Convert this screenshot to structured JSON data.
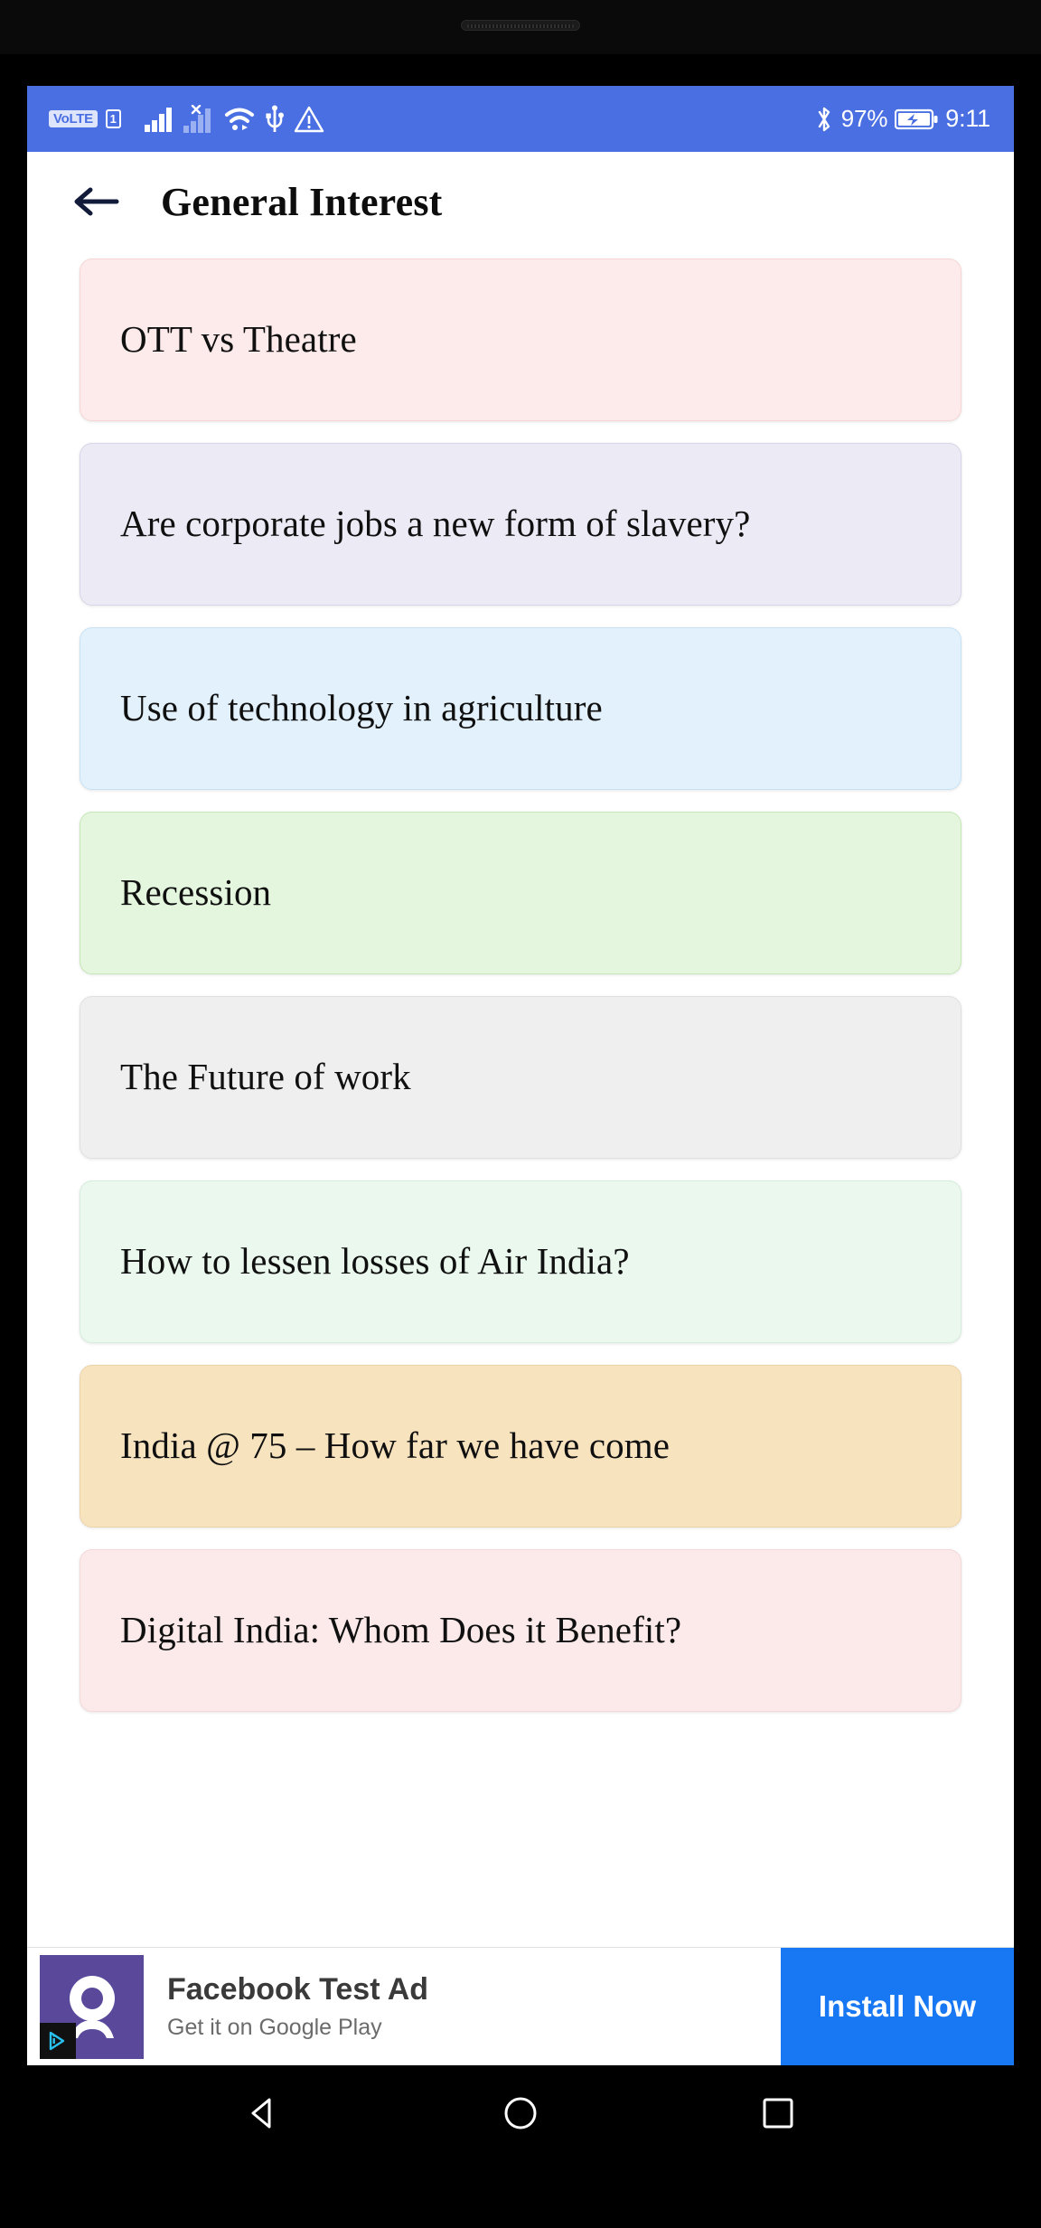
{
  "status_bar": {
    "volte_label": "VoLTE",
    "sim_label": "1",
    "icons": [
      "volte-badge",
      "sim-1-badge",
      "signal-bars-icon",
      "signal-no-service-icon",
      "wifi-icon",
      "usb-icon",
      "warning-triangle-icon",
      "bluetooth-icon",
      "battery-icon"
    ],
    "battery_percent": "97%",
    "time": "9:11",
    "background_color": "#4a6fe3"
  },
  "app_bar": {
    "back_label": "back-arrow",
    "title": "General Interest"
  },
  "topics": [
    {
      "label": "OTT vs Theatre",
      "bg": "#fdeaea",
      "border": "#f6d5d5"
    },
    {
      "label": "Are corporate jobs a new form of slavery?",
      "bg": "#eceaf5",
      "border": "#d9d5e8"
    },
    {
      "label": "Use of technology in agriculture",
      "bg": "#e2f1fb",
      "border": "#c9e2f3"
    },
    {
      "label": "Recession",
      "bg": "#e4f6dd",
      "border": "#c6e8b8"
    },
    {
      "label": "The Future of work",
      "bg": "#efefef",
      "border": "#e0e0e0"
    },
    {
      "label": "How to lessen losses of Air India?",
      "bg": "#eaf8ee",
      "border": "#d6ecdc"
    },
    {
      "label": "India @ 75 – How far we have come",
      "bg": "#f8e3bf",
      "border": "#ecd3a8"
    },
    {
      "label": "Digital India: Whom Does it Benefit?",
      "bg": "#fceaea",
      "border": "#f5d8d8"
    }
  ],
  "ad": {
    "icon_name": "facebook-test-ad-logo",
    "adchoices_icon": "adchoices-icon",
    "title": "Facebook Test Ad",
    "subtitle": "Get it on Google Play",
    "cta_label": "Install Now",
    "cta_color": "#1878f3"
  },
  "nav_bar": {
    "back_key": "back-triangle",
    "home_key": "home-circle",
    "recents_key": "recents-square"
  }
}
